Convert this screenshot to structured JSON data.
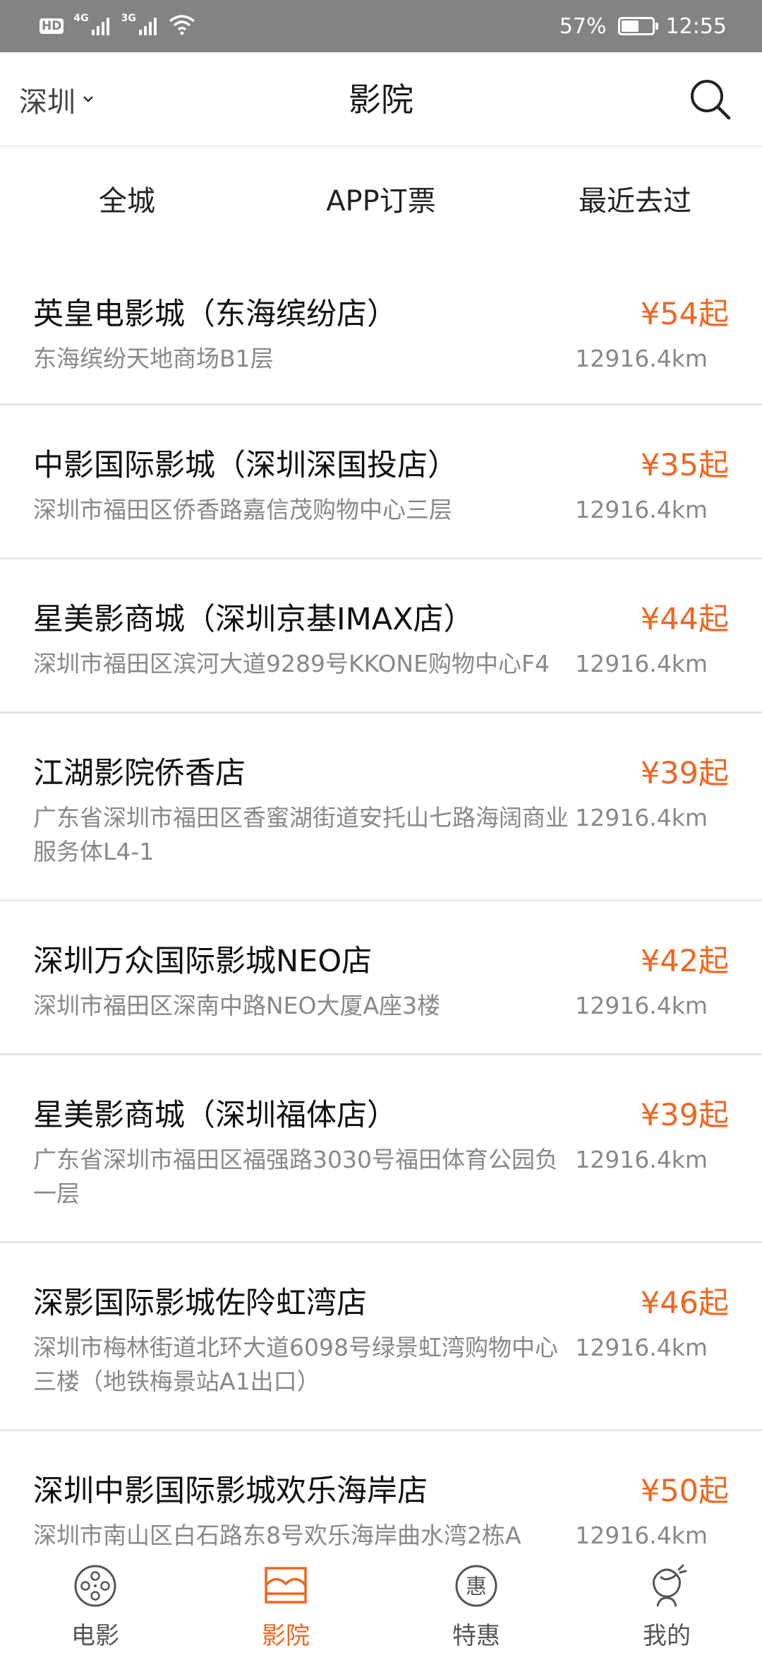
{
  "status_bar": {
    "hd": "HD",
    "net1": "4G",
    "net2": "3G",
    "battery_pct": "57%",
    "battery_level": 0.57,
    "time": "12:55"
  },
  "header": {
    "city": "深圳",
    "title": "影院",
    "icons": {
      "search": "search-icon",
      "city_dropdown": "chevron-down-icon"
    }
  },
  "tabs": [
    "全城",
    "APP订票",
    "最近去过"
  ],
  "cinemas": [
    {
      "name": "英皇电影城（东海缤纷店）",
      "price": "¥54起",
      "address": "东海缤纷天地商场B1层",
      "distance": "12916.4km"
    },
    {
      "name": "中影国际影城（深圳深国投店）",
      "price": "¥35起",
      "address": "深圳市福田区侨香路嘉信茂购物中心三层",
      "distance": "12916.4km"
    },
    {
      "name": "星美影商城（深圳京基IMAX店）",
      "price": "¥44起",
      "address": "深圳市福田区滨河大道9289号KKONE购物中心F4",
      "distance": "12916.4km"
    },
    {
      "name": "江湖影院侨香店",
      "price": "¥39起",
      "address": "广东省深圳市福田区香蜜湖街道安托山七路海阔商业服务体L4-1",
      "distance": "12916.4km"
    },
    {
      "name": "深圳万众国际影城NEO店",
      "price": "¥42起",
      "address": "深圳市福田区深南中路NEO大厦A座3楼",
      "distance": "12916.4km"
    },
    {
      "name": "星美影商城（深圳福体店）",
      "price": "¥39起",
      "address": "广东省深圳市福田区福强路3030号福田体育公园负一层",
      "distance": "12916.4km"
    },
    {
      "name": "深影国际影城佐阾虹湾店",
      "price": "¥46起",
      "address": "深圳市梅林街道北环大道6098号绿景虹湾购物中心三楼（地铁梅景站A1出口）",
      "distance": "12916.4km"
    },
    {
      "name": "深圳中影国际影城欢乐海岸店",
      "price": "¥50起",
      "address": "深圳市南山区白石路东8号欢乐海岸曲水湾2栋A",
      "distance": "12916.4km"
    }
  ],
  "bottom_nav": [
    {
      "label": "电影",
      "icon": "film-reel-icon",
      "active": false
    },
    {
      "label": "影院",
      "icon": "cinema-screen-icon",
      "active": true
    },
    {
      "label": "特惠",
      "icon": "discount-icon",
      "active": false
    },
    {
      "label": "我的",
      "icon": "profile-icon",
      "active": false
    }
  ],
  "colors": {
    "accent": "#f0661f",
    "status_bar": "#838383",
    "divider": "#e6e6e6",
    "secondary_text": "#888888"
  }
}
